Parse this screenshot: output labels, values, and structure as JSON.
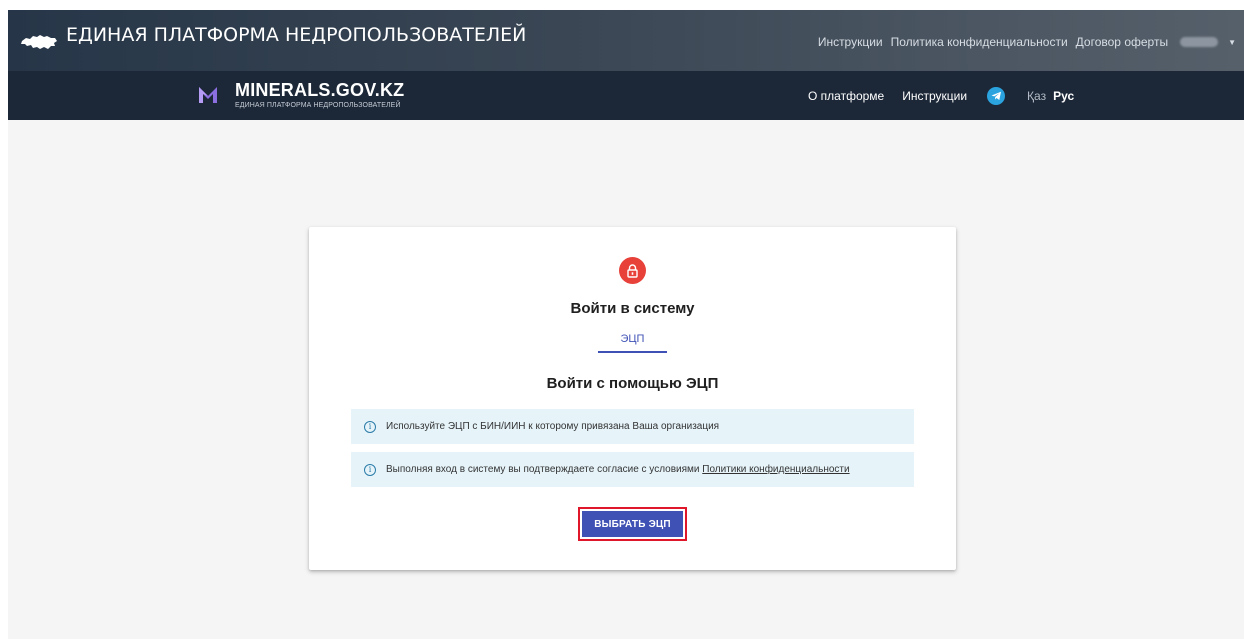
{
  "header": {
    "title": "ЕДИНАЯ ПЛАТФОРМА НЕДРОПОЛЬЗОВАТЕЛЕЙ",
    "links": [
      "Инструкции",
      "Политика конфиденциальности",
      "Договор оферты"
    ]
  },
  "nav": {
    "brand": "MINERALS.GOV.KZ",
    "brand_sub": "ЕДИНАЯ ПЛАТФОРМА НЕДРОПОЛЬЗОВАТЕЛЕЙ",
    "about": "О платформе",
    "instructions": "Инструкции",
    "lang_kz": "Қаз",
    "lang_ru": "Рус"
  },
  "login": {
    "title": "Войти в систему",
    "tab": "ЭЦП",
    "subtitle": "Войти с помощью ЭЦП",
    "alert_1": "Используйте ЭЦП с БИН/ИИН к которому привязана Ваша организация",
    "alert_2_text": "Выполняя вход в систему вы подтверждаете согласие с условиями",
    "alert_2_link": "Политики конфиденциальности",
    "button": "ВЫБРАТЬ ЭЦП"
  },
  "colors": {
    "primary": "#3f51b5",
    "lock": "#e8413a",
    "highlight": "#e0162b",
    "info_bg": "#e6f4fa"
  }
}
